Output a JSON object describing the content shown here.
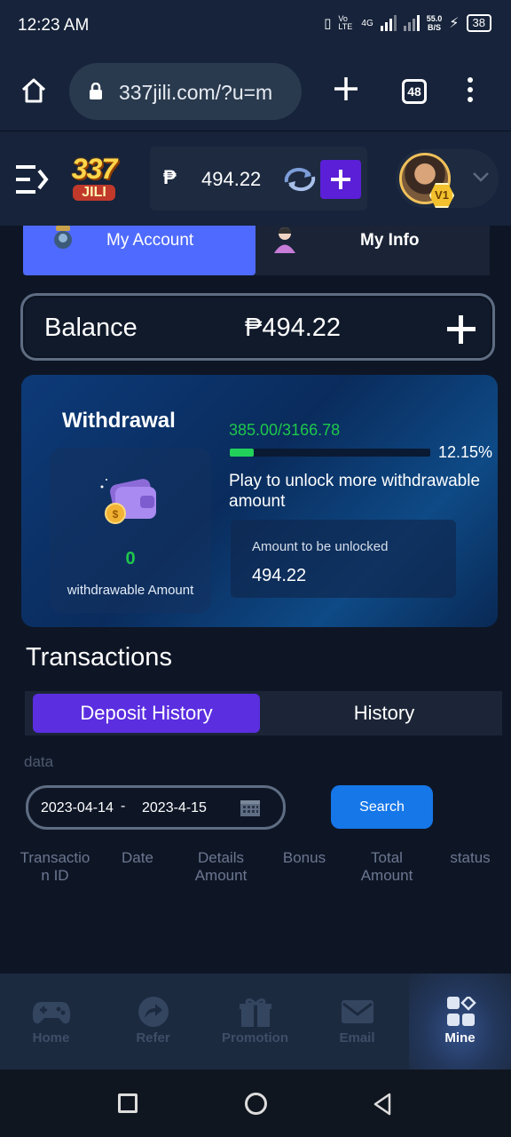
{
  "status_bar": {
    "time": "12:23 AM",
    "net_speed": "55.0",
    "net_unit": "B/S",
    "volte": "Vo LTE",
    "network": "4G",
    "battery": "38"
  },
  "browser": {
    "url": "337jili.com/?u=m",
    "tab_count": "48"
  },
  "header": {
    "logo_number": "337",
    "logo_word": "JILI",
    "currency_symbol": "₱",
    "balance": "494.22",
    "vip_level": "V1"
  },
  "account_tabs": {
    "my_account": "My Account",
    "my_info": "My Info"
  },
  "balance_card": {
    "label": "Balance",
    "value": "₱494.22"
  },
  "withdrawal": {
    "title": "Withdrawal",
    "withdrawable_value": "0",
    "withdrawable_label": "withdrawable Amount",
    "progress_text": "385.00/3166.78",
    "progress_percent_label": "12.15%",
    "progress_fraction": 0.1215,
    "unlock_text": "Play to unlock more withdrawable amount",
    "unlock_label": "Amount to be unlocked",
    "unlock_value": "494.22"
  },
  "transactions": {
    "title": "Transactions",
    "tab_deposit": "Deposit History",
    "tab_history": "History",
    "data_label": "data",
    "date_start": "2023-04-14",
    "date_separator": "-",
    "date_end": "2023-4-15",
    "search_label": "Search",
    "columns": [
      "Transactio n ID",
      "Date",
      "Details Amount",
      "Bonus",
      "Total Amount",
      "status"
    ]
  },
  "bottom_nav": [
    {
      "label": "Home",
      "icon": "gamepad-icon"
    },
    {
      "label": "Refer",
      "icon": "share-icon"
    },
    {
      "label": "Promotion",
      "icon": "gift-icon"
    },
    {
      "label": "Email",
      "icon": "envelope-icon"
    },
    {
      "label": "Mine",
      "icon": "grid-diamond-icon",
      "active": true
    }
  ],
  "colors": {
    "accent_purple": "#5b2ee0",
    "accent_blue": "#4f6bff",
    "success_green": "#1ec74b",
    "search_blue": "#1677e8"
  }
}
